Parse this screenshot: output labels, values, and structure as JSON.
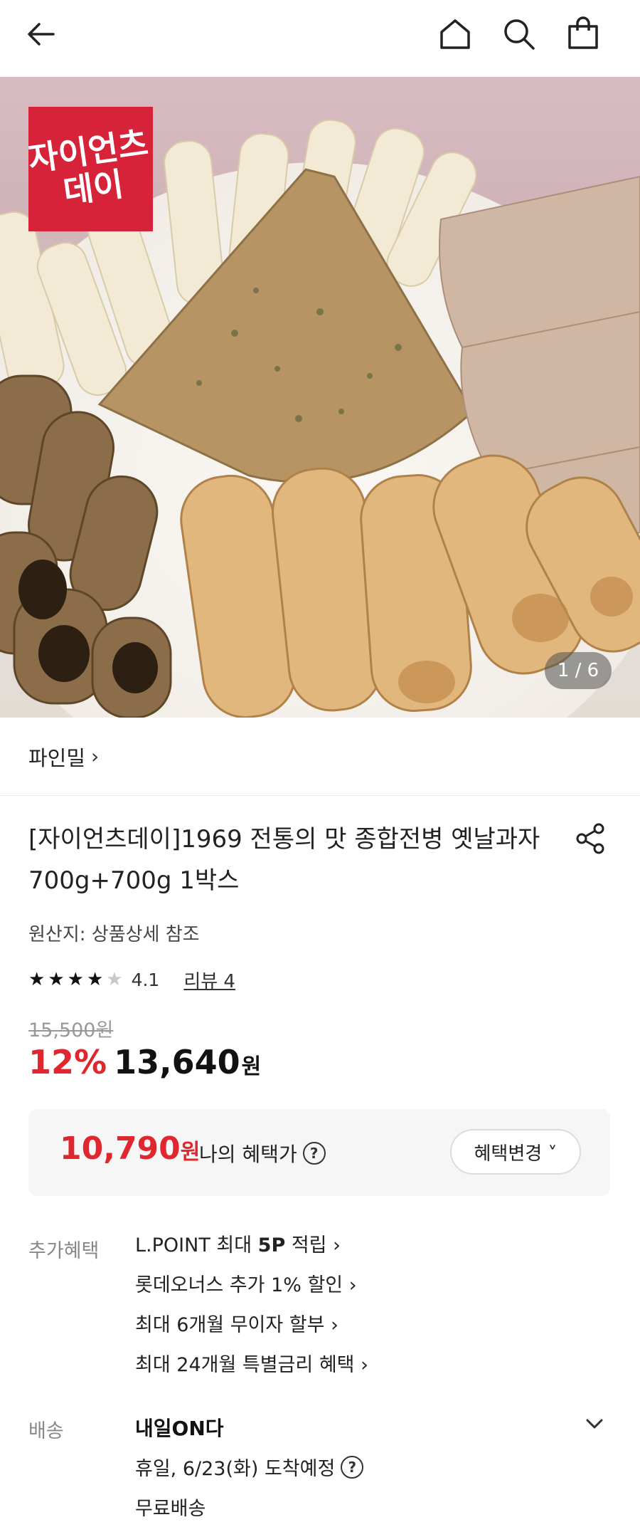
{
  "header": {
    "icons": [
      "back-arrow-icon",
      "home-icon",
      "search-icon",
      "shopping-bag-icon"
    ]
  },
  "hero": {
    "logo_text": "자이언츠\n데이",
    "counter": "1 / 6"
  },
  "seller": {
    "name": "파인밀",
    "chevron": "›"
  },
  "product": {
    "title": "[자이언츠데이]1969 전통의 맛 종합전병 옛날과자 700g+700g 1박스",
    "origin": "원산지: 상품상세 참조",
    "rating": 4.1,
    "rating_text": "4.1",
    "review_label": "리뷰 4",
    "original_price": "15,500원",
    "discount": "12%",
    "price": "13,640",
    "price_unit": "원"
  },
  "benefit": {
    "price": "10,790",
    "unit": "원",
    "label": "나의 혜택가",
    "help": "?",
    "change_button": "혜택변경 ˅"
  },
  "extra_benefits": {
    "label": "추가혜택",
    "items": [
      {
        "pre": "L.POINT 최대 ",
        "bold": "5P",
        "post": " 적립 ›"
      },
      {
        "pre": "롯데오너스 추가 1% 할인 ›",
        "bold": "",
        "post": ""
      },
      {
        "pre": "최대 6개월 무이자 할부 ›",
        "bold": "",
        "post": ""
      },
      {
        "pre": "최대 24개월 특별금리 혜택 ›",
        "bold": "",
        "post": ""
      }
    ]
  },
  "shipping": {
    "label": "배송",
    "title": "내일ON다",
    "date": "휴일, 6/23(화) 도착예정",
    "help": "?",
    "fee": "무료배송"
  },
  "colors": {
    "accent_red": "#e0262f",
    "logo_red": "#d7233a"
  }
}
